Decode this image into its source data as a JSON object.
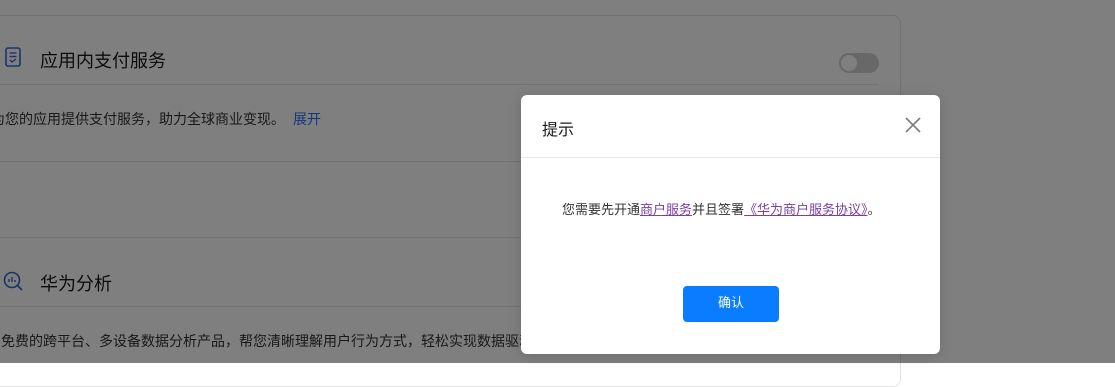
{
  "background": {
    "payment_service": {
      "title": "应用内支付服务",
      "description": "为您的应用提供支付服务，助力全球商业变现。",
      "expand_label": "展开",
      "toggle_on": false
    },
    "analytics_service": {
      "title": "华为分析",
      "description": "免费的跨平台、多设备数据分析产品，帮您清晰理解用户行为方式，轻松实现数据驱动"
    }
  },
  "dialog": {
    "title": "提示",
    "message_prefix": "您需要先开通",
    "merchant_service_link": "商户服务",
    "message_middle": "并且签署",
    "agreement_link": "《华为商户服务协议》",
    "message_suffix": "。",
    "confirm_label": "确认"
  },
  "colors": {
    "primary_button": "#0a7cff",
    "link_visited": "#7b3fa0",
    "expand_link": "#256fff",
    "mask": "rgba(0,0,0,0.5)"
  }
}
